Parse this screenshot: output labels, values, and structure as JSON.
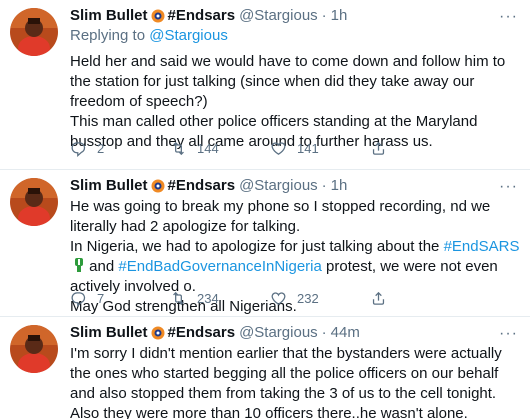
{
  "tweets": [
    {
      "name": "Slim Bullet",
      "tag": "#Endsars",
      "handle": "@Stargious",
      "separator": "·",
      "time": "1h",
      "replying_prefix": "Replying to",
      "replying_to": "@Stargious",
      "lines": [
        "Held her and said we would have to come down and follow him to the station for just talking (since when did they take away our freedom of speech?)",
        "This man called other police officers standing at the Maryland busstop and they all came around to further harass us."
      ],
      "replies": "2",
      "retweets": "144",
      "likes": "141"
    },
    {
      "name": "Slim Bullet",
      "tag": "#Endsars",
      "handle": "@Stargious",
      "separator": "·",
      "time": "1h",
      "line1": "He was going to break my phone so I stopped recording, nd we literally had 2 apologize for talking.",
      "line2_a": "In Nigeria, we had to apologize for just talking about the ",
      "hashtag1": "#EndSARS",
      "line2_b": " and ",
      "hashtag2": "#EndBadGovernanceInNigeria",
      "line2_c": " protest, we were not even actively involved o.",
      "line3": "May God strengthen all Nigerians.",
      "replies": "7",
      "retweets": "234",
      "likes": "232"
    },
    {
      "name": "Slim Bullet",
      "tag": "#Endsars",
      "handle": "@Stargious",
      "separator": "·",
      "time": "44m",
      "line1": "I'm sorry I didn't mention earlier that the bystanders were actually the ones who started begging all the police officers on our behalf and also stopped them from taking the 3 of us to the cell tonight.",
      "line2": "Also they were more than 10 officers there..he wasn't alone."
    }
  ],
  "more_label": "···",
  "colors": {
    "link": "#1b95e0",
    "muted": "#5b7083",
    "divider": "#e6ecf0"
  },
  "icons": [
    "reply-icon",
    "retweet-icon",
    "like-icon",
    "share-icon",
    "more-icon",
    "badge-icon",
    "raised-fist-icon"
  ]
}
